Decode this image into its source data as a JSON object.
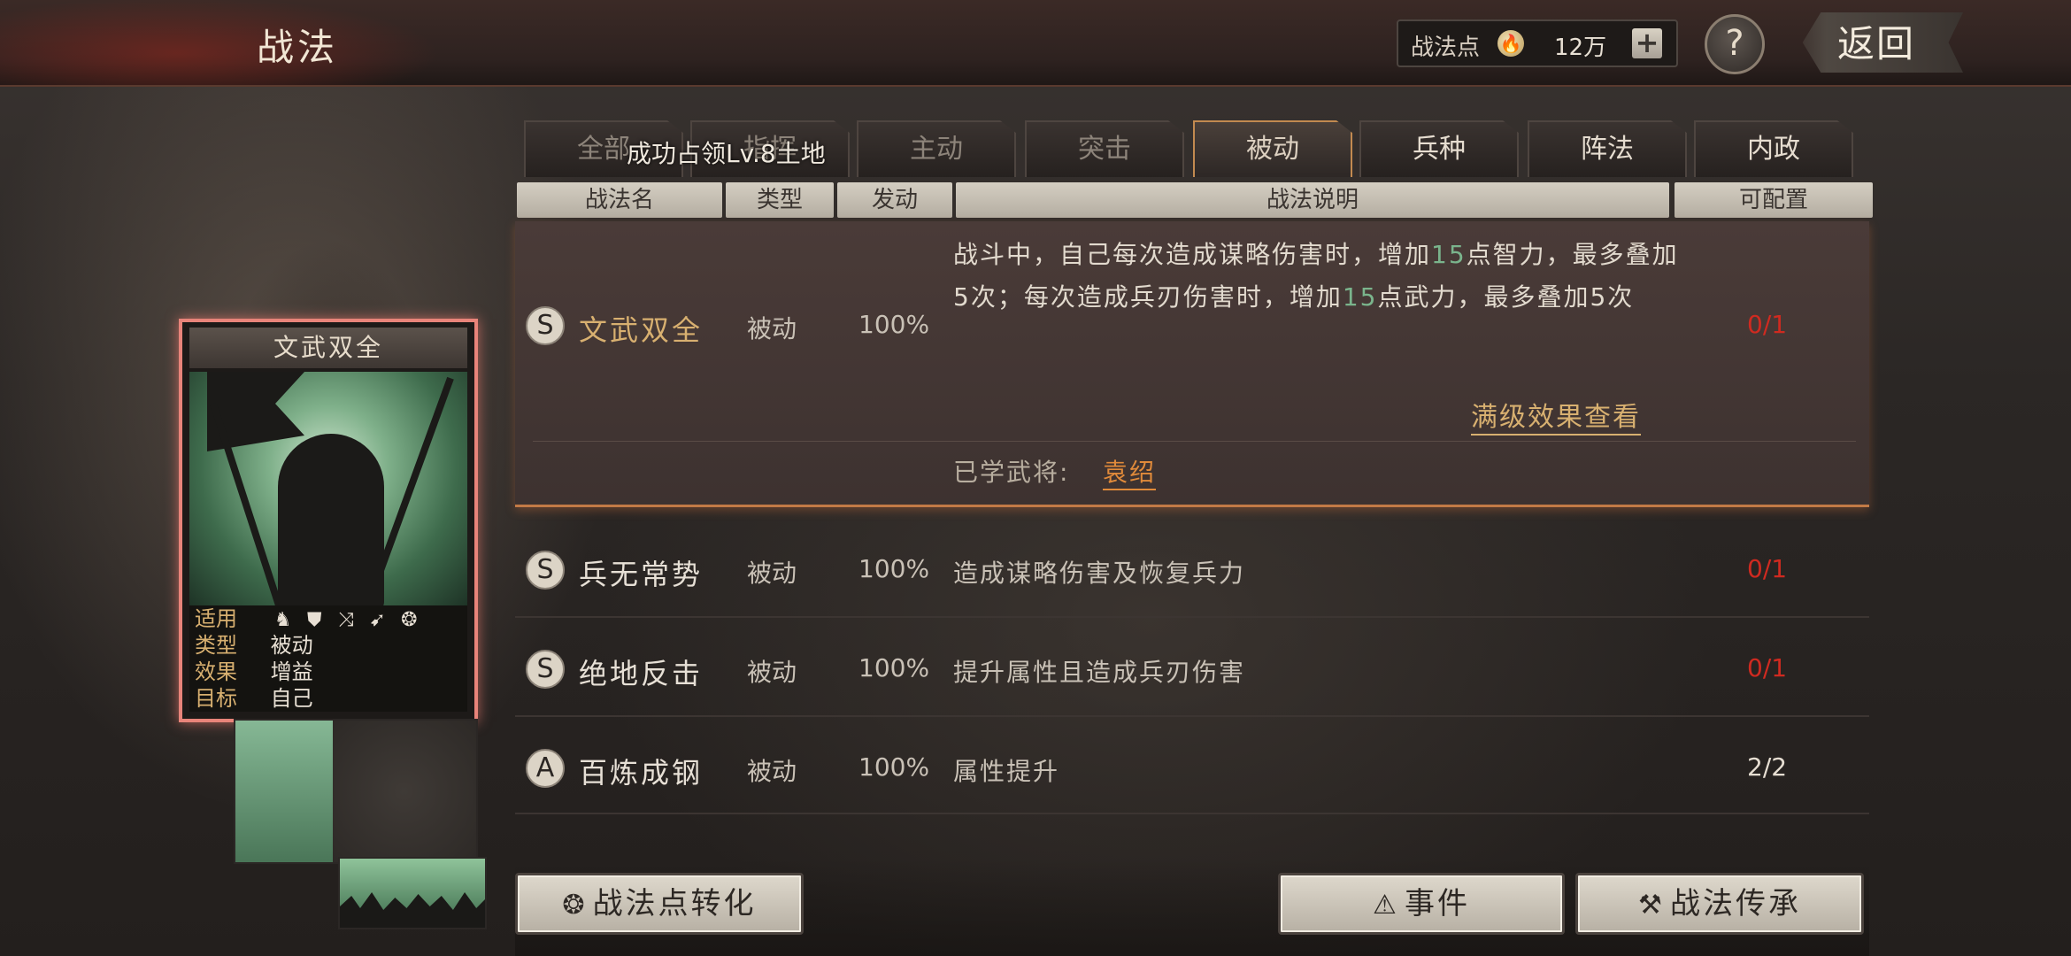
{
  "header": {
    "title": "战法",
    "points_label": "战法点",
    "points_icon": "flame-coin-icon",
    "points_value": "12万",
    "plus_label": "+",
    "help_label": "?",
    "back_label": "返回"
  },
  "tabs": [
    {
      "label": "全部",
      "active": false
    },
    {
      "label": "指挥",
      "active": false
    },
    {
      "label": "主动",
      "active": false
    },
    {
      "label": "突击",
      "active": false
    },
    {
      "label": "被动",
      "active": true
    },
    {
      "label": "兵种",
      "active": false
    },
    {
      "label": "阵法",
      "active": false
    },
    {
      "label": "内政",
      "active": false
    }
  ],
  "toast": "成功占领Lv.8土地",
  "columns": {
    "name": "战法名",
    "type": "类型",
    "rate": "发动",
    "desc": "战法说明",
    "cfg": "可配置"
  },
  "expanded": {
    "grade": "S",
    "name": "文武双全",
    "type": "被动",
    "rate": "100%",
    "desc_parts": [
      "战斗中，自己每次造成谋略伤害时，增加",
      "15",
      "点智力，最多叠加5次；每次造成兵刃伤害时，增加",
      "15",
      "点武力，最多叠加5次"
    ],
    "cfg": "0/1",
    "full_effect_link": "满级效果查看",
    "learned_label": "已学武将:",
    "learned_general": "袁绍"
  },
  "rows": [
    {
      "grade": "S",
      "name": "兵无常势",
      "type": "被动",
      "rate": "100%",
      "desc": "造成谋略伤害及恢复兵力",
      "cfg": "0/1"
    },
    {
      "grade": "S",
      "name": "绝地反击",
      "type": "被动",
      "rate": "100%",
      "desc": "提升属性且造成兵刃伤害",
      "cfg": "0/1"
    },
    {
      "grade": "A",
      "name": "百炼成钢",
      "type": "被动",
      "rate": "100%",
      "desc": "属性提升",
      "cfg": "2/2"
    }
  ],
  "card": {
    "title": "文武双全",
    "apply_label": "适用",
    "unit_icons": [
      "cavalry-icon",
      "shield-icon",
      "bow-icon",
      "spear-icon",
      "wheel-icon"
    ],
    "type_label": "类型",
    "type_value": "被动",
    "effect_label": "效果",
    "effect_value": "增益",
    "target_label": "目标",
    "target_value": "自己"
  },
  "buttons": {
    "convert": "战法点转化",
    "events": "事件",
    "inherit": "战法传承"
  },
  "colors": {
    "accent_gold": "#d8b070",
    "config_red": "#cf2a20",
    "card_border": "#e8847a",
    "highlight_green": "#7ab48c"
  }
}
